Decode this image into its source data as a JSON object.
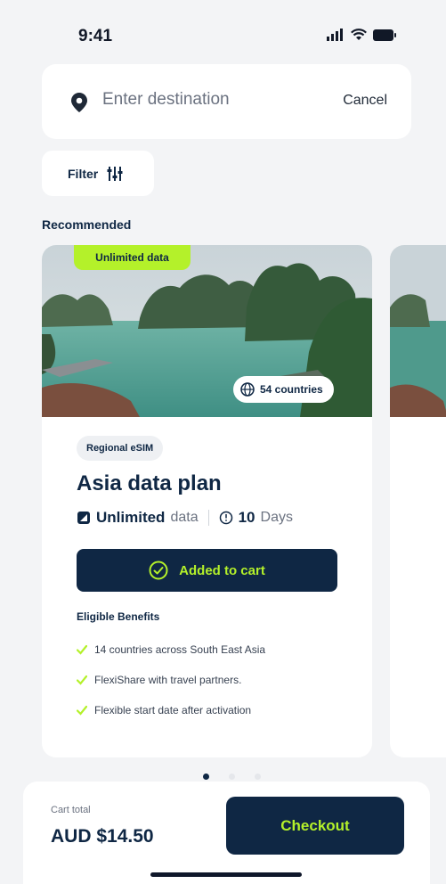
{
  "status": {
    "time": "9:41",
    "icons": [
      "signal-icon",
      "wifi-icon",
      "battery-icon"
    ]
  },
  "search": {
    "placeholder": "Enter destination",
    "value": "",
    "cancel_label": "Cancel"
  },
  "filter": {
    "label": "Filter"
  },
  "section": {
    "title": "Recommended"
  },
  "plan": {
    "badge": "Unlimited data",
    "countries": "54 countries",
    "region": "Regional eSIM",
    "title": "Asia data plan",
    "data_value": "Unlimited",
    "data_unit": "data",
    "days_value": "10",
    "days_unit": "Days",
    "button_label": "Added to cart",
    "benefits_title": "Eligible Benefits",
    "benefits": [
      "14 countries across South East Asia",
      "FlexiShare with travel partners.",
      "Flexible start date after activation"
    ]
  },
  "pager": {
    "active_index": 0,
    "count": 3
  },
  "cart": {
    "label": "Cart total",
    "total": "AUD $14.50",
    "checkout_label": "Checkout"
  },
  "colors": {
    "navy": "#0f2744",
    "lime": "#b4f12a",
    "background": "#f3f4f6"
  }
}
